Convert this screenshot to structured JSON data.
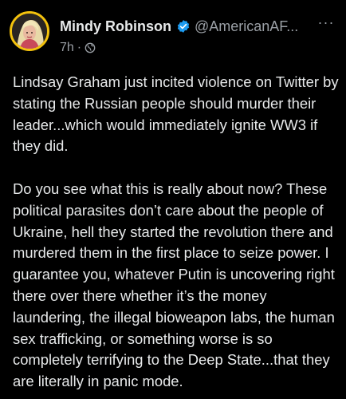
{
  "tweet": {
    "author": {
      "display_name": "Mindy Robinson",
      "handle": "@AmericanAF...",
      "verified": true,
      "avatar_icon": "profile-photo"
    },
    "meta": {
      "time": "7h",
      "separator": "·",
      "audience_icon": "globe-icon"
    },
    "more_label": "···",
    "paragraphs": [
      "Lindsay Graham just incited violence on Twitter by stating the Russian people should murder their leader...which would immediately ignite WW3 if they did.",
      "Do you see what this is really about now? These political parasites don’t care about the people of Ukraine, hell they started the revolution there and murdered them in the first place to seize power. I guarantee you, whatever Putin is uncovering right there over there whether it’s the money laundering, the illegal bioweapon labs, the human sex trafficking, or something worse is so completely terrifying to the Deep State...that they are literally in panic mode."
    ]
  },
  "colors": {
    "background": "#000000",
    "text": "#e7e9ea",
    "secondary_text": "#9a9fa5",
    "verified": "#1d9bf0",
    "avatar_ring": "#f4c20d"
  }
}
